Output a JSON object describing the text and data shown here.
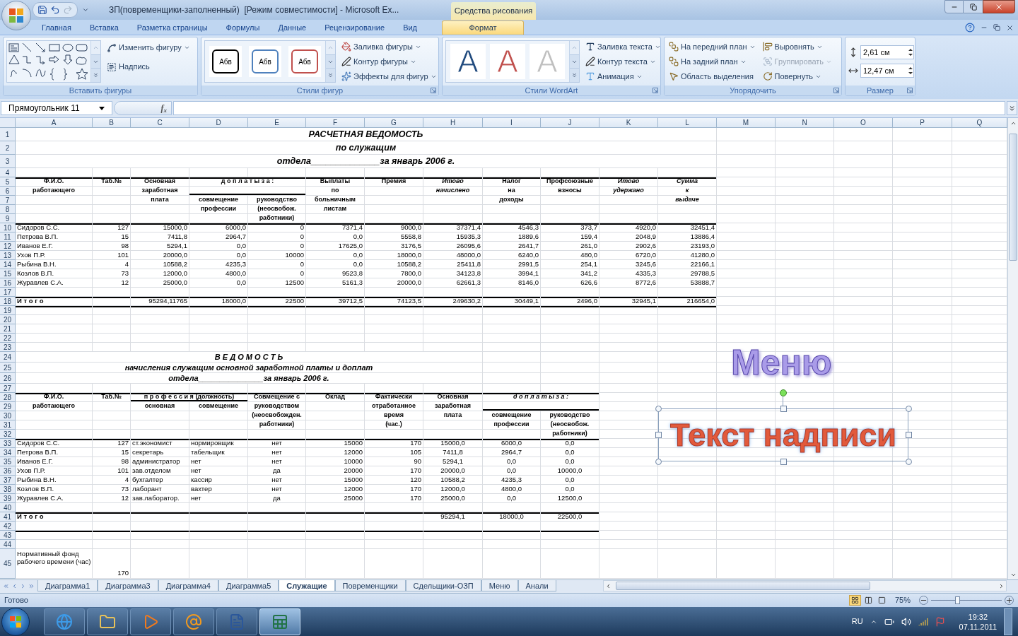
{
  "window": {
    "title": "ЗП(повременщики-заполненный)  [Режим совместимости] - Microsoft Ex...",
    "context_label": "Средства рисования"
  },
  "quick_access": [
    {
      "kind": "save",
      "disabled": false
    },
    {
      "kind": "undo",
      "disabled": false
    },
    {
      "kind": "redo",
      "disabled": true
    }
  ],
  "ribbon_tabs": [
    {
      "label": "Главная",
      "selected": false
    },
    {
      "label": "Вставка",
      "selected": false
    },
    {
      "label": "Разметка страницы",
      "selected": false
    },
    {
      "label": "Формулы",
      "selected": false
    },
    {
      "label": "Данные",
      "selected": false
    },
    {
      "label": "Рецензирование",
      "selected": false
    },
    {
      "label": "Вид",
      "selected": false
    },
    {
      "label": "Формат",
      "selected": true
    }
  ],
  "ribbon_groups": [
    {
      "kind": "insert_shapes",
      "label": "Вставить фигуры",
      "buttons": [
        {
          "label": "Изменить фигуру",
          "dropdown": true
        },
        {
          "label": "Надпись",
          "dropdown": false
        }
      ]
    },
    {
      "kind": "shape_styles",
      "label": "Стили фигур",
      "swatches": [
        {
          "text": "Абв",
          "color": "#000000"
        },
        {
          "text": "Абв",
          "color": "#4f81bd"
        },
        {
          "text": "Абв",
          "color": "#c0504d"
        }
      ],
      "buttons": [
        {
          "label": "Заливка фигуры",
          "dropdown": true
        },
        {
          "label": "Контур фигуры",
          "dropdown": true
        },
        {
          "label": "Эффекты для фигур",
          "dropdown": true
        }
      ]
    },
    {
      "kind": "wordart_styles",
      "label": "Стили WordArt",
      "swatches": [
        {
          "text": "A",
          "color": "#1f497d"
        },
        {
          "text": "A",
          "color": "#c0504d"
        },
        {
          "text": "A",
          "color": "#bfbfbf"
        }
      ],
      "buttons": [
        {
          "label": "Заливка текста",
          "dropdown": true
        },
        {
          "label": "Контур текста",
          "dropdown": true
        },
        {
          "label": "Анимация",
          "dropdown": true
        }
      ]
    },
    {
      "kind": "arrange",
      "label": "Упорядочить",
      "buttons": [
        {
          "label": "На передний план",
          "dropdown": true,
          "disabled": false
        },
        {
          "label": "Выровнять",
          "dropdown": true,
          "disabled": false
        },
        {
          "label": "На задний план",
          "dropdown": true,
          "disabled": false
        },
        {
          "label": "Группировать",
          "dropdown": true,
          "disabled": true
        },
        {
          "label": "Область выделения",
          "dropdown": false,
          "disabled": false
        },
        {
          "label": "Повернуть",
          "dropdown": true,
          "disabled": false
        }
      ]
    },
    {
      "kind": "size",
      "label": "Размер",
      "fields": [
        {
          "value": "2,61 см"
        },
        {
          "value": "12,47 см"
        }
      ]
    }
  ],
  "name_box": "Прямоугольник 11",
  "formula_label": "f$_{x}$",
  "sheet": {
    "columns": [
      "A",
      "B",
      "C",
      "D",
      "E",
      "F",
      "G",
      "H",
      "I",
      "J",
      "K",
      "L",
      "M",
      "N",
      "O",
      "P",
      "Q"
    ],
    "rows": [
      {
        "n": "1",
        "kind": "title",
        "cells": [
          {
            "text": "РАСЧЕТНАЯ ВЕДОМОСТЬ",
            "kind": "t"
          },
          {
            "kind": "merged"
          },
          {
            "kind": "merged"
          },
          {
            "kind": "merged"
          },
          {
            "kind": "merged"
          },
          {
            "kind": "merged"
          },
          {
            "kind": "merged"
          },
          {
            "kind": "merged"
          },
          {
            "kind": "merged"
          },
          {
            "kind": "merged"
          },
          {
            "kind": "merged"
          },
          {
            "kind": "merged"
          }
        ]
      },
      {
        "n": "2",
        "kind": "title",
        "cells": [
          {
            "text": "по служащим",
            "kind": "t"
          },
          {
            "kind": "merged"
          },
          {
            "kind": "merged"
          },
          {
            "kind": "merged"
          },
          {
            "kind": "merged"
          },
          {
            "kind": "merged"
          },
          {
            "kind": "merged"
          },
          {
            "kind": "merged"
          },
          {
            "kind": "merged"
          },
          {
            "kind": "merged"
          },
          {
            "kind": "merged"
          },
          {
            "kind": "merged"
          }
        ]
      },
      {
        "n": "3",
        "kind": "title",
        "cells": [
          {
            "text": "отдела______________за январь 2006 г.",
            "kind": "t"
          },
          {
            "kind": "merged"
          },
          {
            "kind": "merged"
          },
          {
            "kind": "merged"
          },
          {
            "kind": "merged"
          },
          {
            "kind": "merged"
          },
          {
            "kind": "merged"
          },
          {
            "kind": "merged"
          },
          {
            "kind": "merged"
          },
          {
            "kind": "merged"
          },
          {
            "kind": "merged"
          },
          {
            "kind": "merged"
          }
        ]
      },
      {
        "n": "4"
      },
      {
        "n": "5",
        "rule_above": true,
        "cells": [
          {
            "text": "Ф.И.О.",
            "kind": "h"
          },
          {
            "text": "Таб.№",
            "kind": "h"
          },
          {
            "text": "Основная",
            "kind": "h"
          },
          {
            "text": "д о п л а т ы  з а :",
            "kind": "h"
          },
          {
            "kind": "merged"
          },
          {
            "text": "Выплаты",
            "kind": "h"
          },
          {
            "text": "Премия",
            "kind": "h"
          },
          {
            "text": "Итово",
            "kind": "hi"
          },
          {
            "text": "Налог",
            "kind": "h"
          },
          {
            "text": "Профсоюзные",
            "kind": "h"
          },
          {
            "text": "Итово",
            "kind": "hi"
          },
          {
            "text": "Сумма",
            "kind": "hi"
          }
        ]
      },
      {
        "n": "6",
        "cells": [
          {
            "text": "работающего",
            "kind": "h"
          },
          {
            "kind": "blank"
          },
          {
            "text": "заработная",
            "kind": "h"
          },
          {
            "kind": "blank",
            "underlined": true
          },
          {
            "kind": "merged"
          },
          {
            "text": "по",
            "kind": "h"
          },
          {
            "kind": "blank"
          },
          {
            "text": "начислено",
            "kind": "hi"
          },
          {
            "text": "на",
            "kind": "h"
          },
          {
            "text": "взносы",
            "kind": "h"
          },
          {
            "text": "удержано",
            "kind": "hi"
          },
          {
            "text": "к",
            "kind": "hi"
          }
        ]
      },
      {
        "n": "7",
        "cells": [
          {
            "kind": "blank"
          },
          {
            "kind": "blank"
          },
          {
            "text": "плата",
            "kind": "h"
          },
          {
            "text": "совмещение",
            "kind": "h"
          },
          {
            "text": "руководство",
            "kind": "h"
          },
          {
            "text": "больничным",
            "kind": "h"
          },
          {
            "kind": "blank"
          },
          {
            "kind": "blank"
          },
          {
            "text": "доходы",
            "kind": "h"
          },
          {
            "kind": "blank"
          },
          {
            "kind": "blank"
          },
          {
            "text": "выдаче",
            "kind": "hi"
          }
        ]
      },
      {
        "n": "8",
        "cells": [
          {
            "kind": "blank"
          },
          {
            "kind": "blank"
          },
          {
            "kind": "blank"
          },
          {
            "text": "профессии",
            "kind": "h"
          },
          {
            "text": "(неосвобож.",
            "kind": "h"
          },
          {
            "text": "листам",
            "kind": "h"
          }
        ]
      },
      {
        "n": "9",
        "cells": [
          {
            "kind": "blank"
          },
          {
            "kind": "blank"
          },
          {
            "kind": "blank"
          },
          {
            "kind": "blank"
          },
          {
            "text": "работники)",
            "kind": "h"
          }
        ]
      },
      {
        "n": "10",
        "rule_above": true,
        "cells": [
          {
            "text": "Сидоров С.С.",
            "kind": "l"
          },
          {
            "text": "127",
            "kind": "r"
          },
          {
            "text": "15000,0",
            "kind": "r"
          },
          {
            "text": "6000,0",
            "kind": "r"
          },
          {
            "text": "0",
            "kind": "r"
          },
          {
            "text": "7371,4",
            "kind": "r"
          },
          {
            "text": "9000,0",
            "kind": "r"
          },
          {
            "text": "37371,4",
            "kind": "r"
          },
          {
            "text": "4546,3",
            "kind": "r"
          },
          {
            "text": "373,7",
            "kind": "r"
          },
          {
            "text": "4920,0",
            "kind": "r"
          },
          {
            "text": "32451,4",
            "kind": "r"
          }
        ]
      },
      {
        "n": "11",
        "cells": [
          {
            "text": "Петрова В.П.",
            "kind": "l"
          },
          {
            "text": "15",
            "kind": "r"
          },
          {
            "text": "7411,8",
            "kind": "r"
          },
          {
            "text": "2964,7",
            "kind": "r"
          },
          {
            "text": "0",
            "kind": "r"
          },
          {
            "text": "0,0",
            "kind": "r"
          },
          {
            "text": "5558,8",
            "kind": "r"
          },
          {
            "text": "15935,3",
            "kind": "r"
          },
          {
            "text": "1889,6",
            "kind": "r"
          },
          {
            "text": "159,4",
            "kind": "r"
          },
          {
            "text": "2048,9",
            "kind": "r"
          },
          {
            "text": "13886,4",
            "kind": "r"
          }
        ]
      },
      {
        "n": "12",
        "cells": [
          {
            "text": "Иванов Е.Г.",
            "kind": "l"
          },
          {
            "text": "98",
            "kind": "r"
          },
          {
            "text": "5294,1",
            "kind": "r"
          },
          {
            "text": "0,0",
            "kind": "r"
          },
          {
            "text": "0",
            "kind": "r"
          },
          {
            "text": "17625,0",
            "kind": "r"
          },
          {
            "text": "3176,5",
            "kind": "r"
          },
          {
            "text": "26095,6",
            "kind": "r"
          },
          {
            "text": "2641,7",
            "kind": "r"
          },
          {
            "text": "261,0",
            "kind": "r"
          },
          {
            "text": "2902,6",
            "kind": "r"
          },
          {
            "text": "23193,0",
            "kind": "r"
          }
        ]
      },
      {
        "n": "13",
        "cells": [
          {
            "text": "Ухов П.Р.",
            "kind": "l"
          },
          {
            "text": "101",
            "kind": "r"
          },
          {
            "text": "20000,0",
            "kind": "r"
          },
          {
            "text": "0,0",
            "kind": "r"
          },
          {
            "text": "10000",
            "kind": "r"
          },
          {
            "text": "0,0",
            "kind": "r"
          },
          {
            "text": "18000,0",
            "kind": "r"
          },
          {
            "text": "48000,0",
            "kind": "r"
          },
          {
            "text": "6240,0",
            "kind": "r"
          },
          {
            "text": "480,0",
            "kind": "r"
          },
          {
            "text": "6720,0",
            "kind": "r"
          },
          {
            "text": "41280,0",
            "kind": "r"
          }
        ]
      },
      {
        "n": "14",
        "cells": [
          {
            "text": "Рыбина В.Н.",
            "kind": "l"
          },
          {
            "text": "4",
            "kind": "r"
          },
          {
            "text": "10588,2",
            "kind": "r"
          },
          {
            "text": "4235,3",
            "kind": "r"
          },
          {
            "text": "0",
            "kind": "r"
          },
          {
            "text": "0,0",
            "kind": "r"
          },
          {
            "text": "10588,2",
            "kind": "r"
          },
          {
            "text": "25411,8",
            "kind": "r"
          },
          {
            "text": "2991,5",
            "kind": "r"
          },
          {
            "text": "254,1",
            "kind": "r"
          },
          {
            "text": "3245,6",
            "kind": "r"
          },
          {
            "text": "22166,1",
            "kind": "r"
          }
        ]
      },
      {
        "n": "15",
        "cells": [
          {
            "text": "Козлов В.П.",
            "kind": "l"
          },
          {
            "text": "73",
            "kind": "r"
          },
          {
            "text": "12000,0",
            "kind": "r"
          },
          {
            "text": "4800,0",
            "kind": "r"
          },
          {
            "text": "0",
            "kind": "r"
          },
          {
            "text": "9523,8",
            "kind": "r"
          },
          {
            "text": "7800,0",
            "kind": "r"
          },
          {
            "text": "34123,8",
            "kind": "r"
          },
          {
            "text": "3994,1",
            "kind": "r"
          },
          {
            "text": "341,2",
            "kind": "r"
          },
          {
            "text": "4335,3",
            "kind": "r"
          },
          {
            "text": "29788,5",
            "kind": "r"
          }
        ]
      },
      {
        "n": "16",
        "cells": [
          {
            "text": "Журавлев С.А.",
            "kind": "l"
          },
          {
            "text": "12",
            "kind": "r"
          },
          {
            "text": "25000,0",
            "kind": "r"
          },
          {
            "text": "0,0",
            "kind": "r"
          },
          {
            "text": "12500",
            "kind": "r"
          },
          {
            "text": "5161,3",
            "kind": "r"
          },
          {
            "text": "20000,0",
            "kind": "r"
          },
          {
            "text": "62661,3",
            "kind": "r"
          },
          {
            "text": "8146,0",
            "kind": "r"
          },
          {
            "text": "626,6",
            "kind": "r"
          },
          {
            "text": "8772,6",
            "kind": "r"
          },
          {
            "text": "53888,7",
            "kind": "r"
          }
        ]
      },
      {
        "n": "17"
      },
      {
        "n": "18",
        "rule_above": true,
        "cells": [
          {
            "text": "И т о г о",
            "kind": "tl"
          },
          {
            "kind": "blank"
          },
          {
            "text": "95294,11765",
            "kind": "r"
          },
          {
            "text": "18000,0",
            "kind": "r"
          },
          {
            "text": "22500",
            "kind": "r"
          },
          {
            "text": "39712,5",
            "kind": "r"
          },
          {
            "text": "74123,5",
            "kind": "r"
          },
          {
            "text": "249630,2",
            "kind": "r"
          },
          {
            "text": "30449,1",
            "kind": "r"
          },
          {
            "text": "2496,0",
            "kind": "r"
          },
          {
            "text": "32945,1",
            "kind": "r"
          },
          {
            "text": "216654,0",
            "kind": "r"
          }
        ]
      },
      {
        "n": "19",
        "rule_above": true
      },
      {
        "n": "20"
      },
      {
        "n": "21"
      },
      {
        "n": "22"
      },
      {
        "n": "23"
      },
      {
        "n": "24",
        "kind": "subtitle",
        "cells": [
          {
            "text": "В Е Д О М О С Т Ь",
            "kind": "t"
          },
          {
            "kind": "merged"
          },
          {
            "kind": "merged"
          },
          {
            "kind": "merged"
          },
          {
            "kind": "merged"
          },
          {
            "kind": "merged"
          },
          {
            "kind": "merged"
          },
          {
            "kind": "merged"
          }
        ]
      },
      {
        "n": "25",
        "kind": "subtitle",
        "cells": [
          {
            "text": "начисления служащим основной заработной платы и доплат",
            "kind": "t"
          },
          {
            "kind": "merged"
          },
          {
            "kind": "merged"
          },
          {
            "kind": "merged"
          },
          {
            "kind": "merged"
          },
          {
            "kind": "merged"
          },
          {
            "kind": "merged"
          },
          {
            "kind": "merged"
          }
        ]
      },
      {
        "n": "26",
        "kind": "subtitle",
        "cells": [
          {
            "text": "отдела_______________за январь 2006 г.",
            "kind": "t"
          },
          {
            "kind": "merged"
          },
          {
            "kind": "merged"
          },
          {
            "kind": "merged"
          },
          {
            "kind": "merged"
          },
          {
            "kind": "merged"
          },
          {
            "kind": "merged"
          },
          {
            "kind": "merged"
          }
        ]
      },
      {
        "n": "27"
      },
      {
        "n": "28",
        "rule_above": true,
        "cells": [
          {
            "text": "Ф.И.О.",
            "kind": "h"
          },
          {
            "text": "Таб.№",
            "kind": "h"
          },
          {
            "text": "п р о ф е с с и я (должность)",
            "kind": "h",
            "underlined": true
          },
          {
            "kind": "merged"
          },
          {
            "text": "Совмещение с",
            "kind": "h"
          },
          {
            "text": "Оклад",
            "kind": "h"
          },
          {
            "text": "Фактически",
            "kind": "h"
          },
          {
            "text": "Основная",
            "kind": "h"
          },
          {
            "text": "д о п л а т ы  з а :",
            "kind": "hi"
          },
          {
            "kind": "merged"
          }
        ]
      },
      {
        "n": "29",
        "cells": [
          {
            "text": "работающего",
            "kind": "h"
          },
          {
            "kind": "blank"
          },
          {
            "text": "основная",
            "kind": "h"
          },
          {
            "text": "совмещение",
            "kind": "h"
          },
          {
            "text": "руководством",
            "kind": "h"
          },
          {
            "kind": "blank"
          },
          {
            "text": "отработанное",
            "kind": "h"
          },
          {
            "text": "заработная",
            "kind": "h"
          },
          {
            "kind": "blank",
            "underlined": true
          },
          {
            "kind": "merged"
          }
        ]
      },
      {
        "n": "30",
        "cells": [
          {
            "kind": "blank"
          },
          {
            "kind": "blank"
          },
          {
            "kind": "blank"
          },
          {
            "kind": "blank"
          },
          {
            "text": "(неосвобожден.",
            "kind": "h"
          },
          {
            "kind": "blank"
          },
          {
            "text": "время",
            "kind": "h"
          },
          {
            "text": "плата",
            "kind": "h"
          },
          {
            "text": "совмещение",
            "kind": "h"
          },
          {
            "text": "руководство",
            "kind": "h"
          }
        ]
      },
      {
        "n": "31",
        "cells": [
          {
            "kind": "blank"
          },
          {
            "kind": "blank"
          },
          {
            "kind": "blank"
          },
          {
            "kind": "blank"
          },
          {
            "text": "работники)",
            "kind": "h"
          },
          {
            "kind": "blank"
          },
          {
            "text": "(час.)",
            "kind": "h"
          },
          {
            "kind": "blank"
          },
          {
            "text": "профессии",
            "kind": "h"
          },
          {
            "text": "(неосвобож.",
            "kind": "h"
          }
        ]
      },
      {
        "n": "32",
        "cells": [
          {
            "kind": "blank"
          },
          {
            "kind": "blank"
          },
          {
            "kind": "blank"
          },
          {
            "kind": "blank"
          },
          {
            "kind": "blank"
          },
          {
            "kind": "blank"
          },
          {
            "kind": "blank"
          },
          {
            "kind": "blank"
          },
          {
            "kind": "blank"
          },
          {
            "text": "работники)",
            "kind": "h"
          }
        ]
      },
      {
        "n": "33",
        "rule_above": true,
        "cells": [
          {
            "text": "Сидоров С.С.",
            "kind": "l"
          },
          {
            "text": "127",
            "kind": "r"
          },
          {
            "text": "ст.экономист",
            "kind": "l"
          },
          {
            "text": "нормировщик",
            "kind": "l"
          },
          {
            "text": "нет",
            "kind": "c"
          },
          {
            "text": "15000",
            "kind": "r"
          },
          {
            "text": "170",
            "kind": "r"
          },
          {
            "text": "15000,0",
            "kind": "c"
          },
          {
            "text": "6000,0",
            "kind": "c"
          },
          {
            "text": "0,0",
            "kind": "c"
          }
        ]
      },
      {
        "n": "34",
        "cells": [
          {
            "text": "Петрова В.П.",
            "kind": "l"
          },
          {
            "text": "15",
            "kind": "r"
          },
          {
            "text": "секретарь",
            "kind": "l"
          },
          {
            "text": "табельщик",
            "kind": "l"
          },
          {
            "text": "нет",
            "kind": "c"
          },
          {
            "text": "12000",
            "kind": "r"
          },
          {
            "text": "105",
            "kind": "r"
          },
          {
            "text": "7411,8",
            "kind": "c"
          },
          {
            "text": "2964,7",
            "kind": "c"
          },
          {
            "text": "0,0",
            "kind": "c"
          }
        ]
      },
      {
        "n": "35",
        "cells": [
          {
            "text": "Иванов Е.Г.",
            "kind": "l"
          },
          {
            "text": "98",
            "kind": "r"
          },
          {
            "text": "администратор",
            "kind": "l"
          },
          {
            "text": "нет",
            "kind": "l"
          },
          {
            "text": "нет",
            "kind": "c"
          },
          {
            "text": "10000",
            "kind": "r"
          },
          {
            "text": "90",
            "kind": "r"
          },
          {
            "text": "5294,1",
            "kind": "c"
          },
          {
            "text": "0,0",
            "kind": "c"
          },
          {
            "text": "0,0",
            "kind": "c"
          }
        ]
      },
      {
        "n": "36",
        "cells": [
          {
            "text": "Ухов П.Р.",
            "kind": "l"
          },
          {
            "text": "101",
            "kind": "r"
          },
          {
            "text": "зав.отделом",
            "kind": "l"
          },
          {
            "text": "нет",
            "kind": "l"
          },
          {
            "text": "да",
            "kind": "c"
          },
          {
            "text": "20000",
            "kind": "r"
          },
          {
            "text": "170",
            "kind": "r"
          },
          {
            "text": "20000,0",
            "kind": "c"
          },
          {
            "text": "0,0",
            "kind": "c"
          },
          {
            "text": "10000,0",
            "kind": "c"
          }
        ]
      },
      {
        "n": "37",
        "cells": [
          {
            "text": "Рыбина В.Н.",
            "kind": "l"
          },
          {
            "text": "4",
            "kind": "r"
          },
          {
            "text": "бухгалтер",
            "kind": "l"
          },
          {
            "text": "кассир",
            "kind": "l"
          },
          {
            "text": "нет",
            "kind": "c"
          },
          {
            "text": "15000",
            "kind": "r"
          },
          {
            "text": "120",
            "kind": "r"
          },
          {
            "text": "10588,2",
            "kind": "c"
          },
          {
            "text": "4235,3",
            "kind": "c"
          },
          {
            "text": "0,0",
            "kind": "c"
          }
        ]
      },
      {
        "n": "38",
        "cells": [
          {
            "text": "Козлов В.П.",
            "kind": "l"
          },
          {
            "text": "73",
            "kind": "r"
          },
          {
            "text": "лаборант",
            "kind": "l"
          },
          {
            "text": "вахтер",
            "kind": "l"
          },
          {
            "text": "нет",
            "kind": "c"
          },
          {
            "text": "12000",
            "kind": "r"
          },
          {
            "text": "170",
            "kind": "r"
          },
          {
            "text": "12000,0",
            "kind": "c"
          },
          {
            "text": "4800,0",
            "kind": "c"
          },
          {
            "text": "0,0",
            "kind": "c"
          }
        ]
      },
      {
        "n": "39",
        "cells": [
          {
            "text": "Журавлев С.А.",
            "kind": "l"
          },
          {
            "text": "12",
            "kind": "r"
          },
          {
            "text": "зав.лаборатор.",
            "kind": "l"
          },
          {
            "text": "нет",
            "kind": "l"
          },
          {
            "text": "да",
            "kind": "c"
          },
          {
            "text": "25000",
            "kind": "r"
          },
          {
            "text": "170",
            "kind": "r"
          },
          {
            "text": "25000,0",
            "kind": "c"
          },
          {
            "text": "0,0",
            "kind": "c"
          },
          {
            "text": "12500,0",
            "kind": "c"
          }
        ]
      },
      {
        "n": "40"
      },
      {
        "n": "41",
        "rule_above": true,
        "cells": [
          {
            "text": "И т о г о",
            "kind": "tl"
          },
          {
            "kind": "blank"
          },
          {
            "kind": "blank"
          },
          {
            "kind": "blank"
          },
          {
            "kind": "blank"
          },
          {
            "kind": "blank"
          },
          {
            "kind": "blank"
          },
          {
            "text": "95294,1",
            "kind": "c"
          },
          {
            "text": "18000,0",
            "kind": "c"
          },
          {
            "text": "22500,0",
            "kind": "c"
          }
        ]
      },
      {
        "n": "42"
      },
      {
        "n": "43",
        "rule_above": true
      },
      {
        "n": "44"
      },
      {
        "n": "45",
        "kind": "tall",
        "cells": [
          {
            "text": "Нормативный фонд рабочего времени (час)",
            "kind": "w"
          },
          {
            "text": "170",
            "kind": "r"
          }
        ]
      }
    ]
  },
  "shapes": [
    {
      "kind": "wordart",
      "text": "Меню",
      "selected": false
    },
    {
      "kind": "textbox",
      "text": "Текст надписи",
      "selected": true
    }
  ],
  "sheet_tabs": [
    {
      "label": "Диаграмма1",
      "selected": false
    },
    {
      "label": "Диаграмма3",
      "selected": false
    },
    {
      "label": "Диаграмма4",
      "selected": false
    },
    {
      "label": "Диаграмма5",
      "selected": false
    },
    {
      "label": "Служащие",
      "selected": true
    },
    {
      "label": "Повременщики",
      "selected": false
    },
    {
      "label": "Сдельщики-ОЗП",
      "selected": false
    },
    {
      "label": "Меню",
      "selected": false
    },
    {
      "label": "Анали",
      "selected": false
    }
  ],
  "status": {
    "text": "Готово",
    "view_buttons": [
      {
        "selected": true
      },
      {
        "selected": false
      },
      {
        "selected": false
      }
    ],
    "zoom": "75%",
    "zoom_slider": {
      "level": 0.37
    }
  },
  "taskbar": {
    "apps": [
      {
        "selected": false
      },
      {
        "selected": false
      },
      {
        "selected": false
      },
      {
        "selected": false
      },
      {
        "selected": false
      },
      {
        "selected": true
      }
    ],
    "language": "RU",
    "time": "19:32",
    "date": "07.11.2011"
  }
}
